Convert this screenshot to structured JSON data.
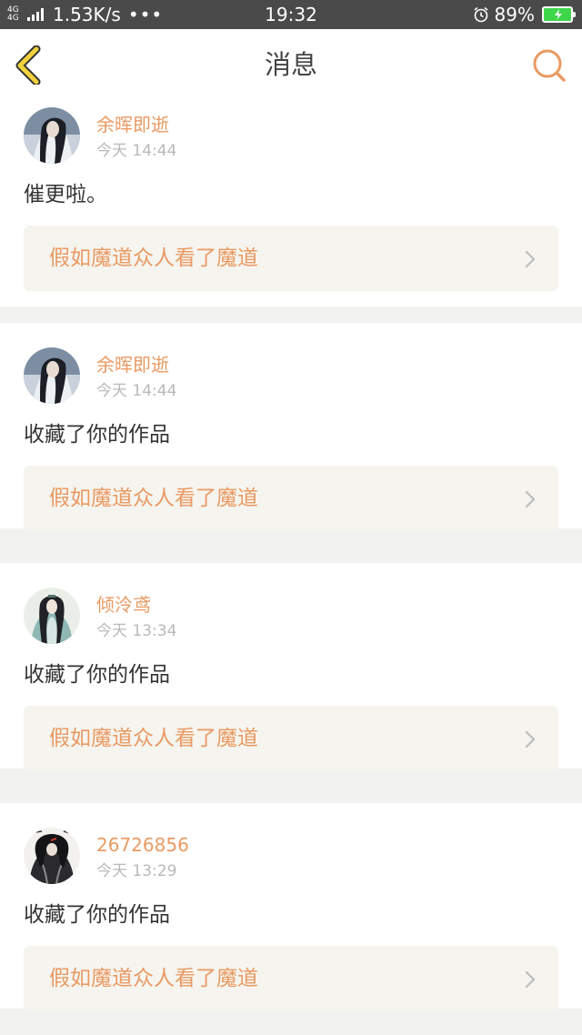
{
  "status_bar": {
    "network_type_1": "4G",
    "network_type_2": "4G",
    "speed": "1.53K/s",
    "dots": "•••",
    "time": "19:32",
    "battery_percent": "89%",
    "icons": [
      "signal-icon",
      "alarm-icon",
      "battery-charging-icon"
    ],
    "battery_level": 0.89
  },
  "nav": {
    "title": "消息",
    "back_icon": "chevron-left-icon",
    "search_icon": "search-icon"
  },
  "colors": {
    "accent": "#e99a63",
    "back_icon": "#f0d23c",
    "card_link_bg": "#f5f4ee",
    "status_bar_bg": "#4a4a4a"
  },
  "messages": [
    {
      "user": "余晖即逝",
      "time": "今天 14:44",
      "text": "催更啦。",
      "work_title": "假如魔道众人看了魔道",
      "avatar": "avatar-1"
    },
    {
      "user": "余晖即逝",
      "time": "今天 14:44",
      "text": "收藏了你的作品",
      "work_title": "假如魔道众人看了魔道",
      "avatar": "avatar-1"
    },
    {
      "user": "倾泠鸢",
      "time": "今天 13:34",
      "text": "收藏了你的作品",
      "work_title": "假如魔道众人看了魔道",
      "avatar": "avatar-2"
    },
    {
      "user": "26726856",
      "time": "今天 13:29",
      "text": "收藏了你的作品",
      "work_title": "假如魔道众人看了魔道",
      "avatar": "avatar-3"
    }
  ]
}
